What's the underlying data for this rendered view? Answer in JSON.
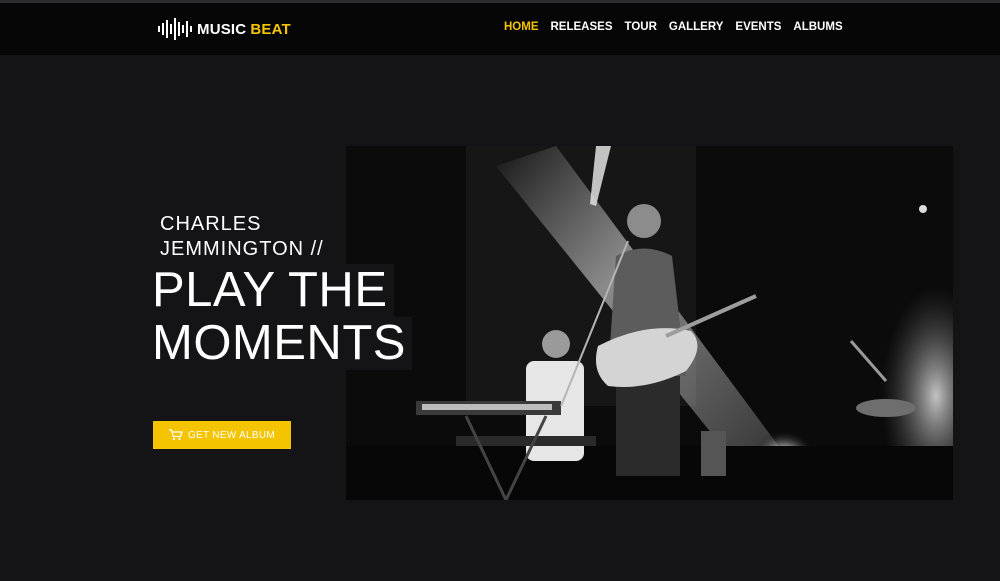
{
  "brand": {
    "word1": "MUSIC",
    "word2": "BEAT",
    "accent_color": "#f5c400",
    "icon": "sound-wave-icon"
  },
  "nav": {
    "items": [
      {
        "label": "HOME",
        "active": true
      },
      {
        "label": "RELEASES",
        "active": false
      },
      {
        "label": "TOUR",
        "active": false
      },
      {
        "label": "GALLERY",
        "active": false
      },
      {
        "label": "EVENTS",
        "active": false
      },
      {
        "label": "ALBUMS",
        "active": false
      }
    ]
  },
  "hero": {
    "artist_line1": "CHARLES",
    "artist_line2": "JEMMINGTON //",
    "headline_line1": "PLAY THE",
    "headline_line2": "MOMENTS",
    "cta_label": "GET NEW ALBUM",
    "cta_icon": "cart-icon",
    "image": "black-and-white-concert-photo"
  },
  "colors": {
    "background": "#141416",
    "navbar": "#060606",
    "accent": "#f5c400"
  }
}
